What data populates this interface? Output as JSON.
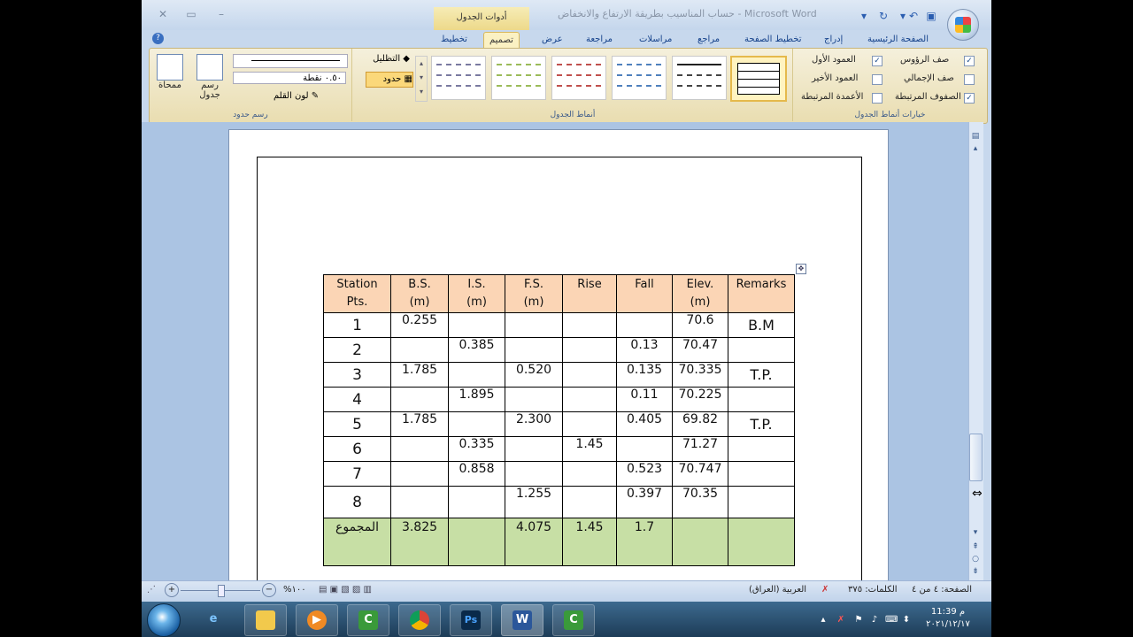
{
  "window": {
    "title": "حساب المناسيب بطريقة الارتفاع والانخفاض - Microsoft Word",
    "context_tab": "أدوات الجدول"
  },
  "tabs": [
    "الصفحة الرئيسية",
    "إدراج",
    "تخطيط الصفحة",
    "مراجع",
    "مراسلات",
    "مراجعة",
    "عرض",
    "تصميم",
    "تخطيط"
  ],
  "active_tab": "تصميم",
  "ribbon": {
    "options_group": {
      "label": "خيارات أنماط الجدول",
      "items": [
        {
          "label": "صف الرؤوس",
          "checked": true
        },
        {
          "label": "العمود الأول",
          "checked": true
        },
        {
          "label": "صف الإجمالي",
          "checked": false
        },
        {
          "label": "العمود الأخير",
          "checked": false
        },
        {
          "label": "الصفوف المرتبطة",
          "checked": true
        },
        {
          "label": "الأعمدة المرتبطة",
          "checked": false
        }
      ]
    },
    "styles_group": {
      "label": "أنماط الجدول",
      "shading": "التظليل",
      "borders": "حدود"
    },
    "draw_group": {
      "label": "رسم حدود",
      "pen_weight": "٠.٥٠ نقطة",
      "pen_color": "لون القلم",
      "draw_table": "رسم جدول",
      "eraser": "ممحاة"
    }
  },
  "table": {
    "headers": [
      [
        "Station",
        "Pts."
      ],
      [
        "B.S.",
        "(m)"
      ],
      [
        "I.S.",
        "(m)"
      ],
      [
        "F.S.",
        "(m)"
      ],
      [
        "Rise",
        ""
      ],
      [
        "Fall",
        ""
      ],
      [
        "Elev.",
        "(m)"
      ],
      [
        "Remarks",
        ""
      ]
    ],
    "rows": [
      [
        "1",
        "0.255",
        "",
        "",
        "",
        "",
        "70.6",
        "B.M"
      ],
      [
        "2",
        "",
        "0.385",
        "",
        "",
        "0.13",
        "70.47",
        ""
      ],
      [
        "3",
        "1.785",
        "",
        "0.520",
        "",
        "0.135",
        "70.335",
        "T.P."
      ],
      [
        "4",
        "",
        "1.895",
        "",
        "",
        "0.11",
        "70.225",
        ""
      ],
      [
        "5",
        "1.785",
        "",
        "2.300",
        "",
        "0.405",
        "69.82",
        "T.P."
      ],
      [
        "6",
        "",
        "0.335",
        "",
        "1.45",
        "",
        "71.27",
        ""
      ],
      [
        "7",
        "",
        "0.858",
        "",
        "",
        "0.523",
        "70.747",
        ""
      ],
      [
        "8",
        "",
        "",
        "1.255",
        "",
        "0.397",
        "70.35",
        ""
      ]
    ],
    "total": [
      "المجموع",
      "3.825",
      "",
      "4.075",
      "1.45",
      "1.7",
      "",
      ""
    ]
  },
  "statusbar": {
    "page": "الصفحة: ٤ من ٤",
    "words": "الكلمات: ٣٧٥",
    "language": "العربية (العراق)",
    "zoom": "%١٠٠"
  },
  "taskbar": {
    "time": "11:39 م",
    "date": "٢٠٢١/١٢/١٧"
  }
}
